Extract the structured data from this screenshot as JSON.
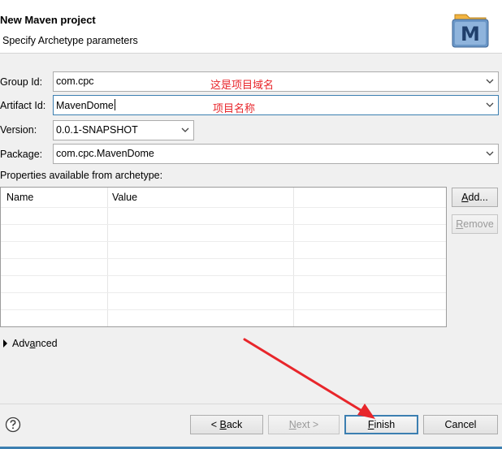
{
  "header": {
    "title": "New Maven project",
    "subtitle": "Specify Archetype parameters",
    "logo_letter": "M"
  },
  "fields": {
    "group_id": {
      "label": "Group Id:",
      "value": "com.cpc",
      "annotation": "这是项目域名"
    },
    "artifact_id": {
      "label": "Artifact Id:",
      "value": "MavenDome",
      "annotation": "项目名称"
    },
    "version": {
      "label": "Version:",
      "value": "0.0.1-SNAPSHOT"
    },
    "package": {
      "label": "Package:",
      "value": "com.cpc.MavenDome"
    }
  },
  "properties": {
    "label": "Properties available from archetype:",
    "columns": [
      "Name",
      "Value"
    ],
    "add_button": {
      "pre": "",
      "mnemonic": "A",
      "post": "dd..."
    },
    "remove_button": {
      "pre": "",
      "mnemonic": "R",
      "post": "emove"
    }
  },
  "advanced": {
    "pre": "Adv",
    "mnemonic": "a",
    "post": "nced"
  },
  "buttons": {
    "back": {
      "pre": "< ",
      "mnemonic": "B",
      "post": "ack"
    },
    "next": {
      "pre": "",
      "mnemonic": "N",
      "post": "ext >"
    },
    "finish": {
      "pre": "",
      "mnemonic": "F",
      "post": "inish"
    },
    "cancel": {
      "label": "Cancel"
    }
  },
  "help_icon": "question-mark-icon",
  "colors": {
    "annotation_red": "#e8262b",
    "focus_blue": "#3c7fb1",
    "logo_blue": "#6b97c7",
    "logo_gold": "#f2b441"
  }
}
